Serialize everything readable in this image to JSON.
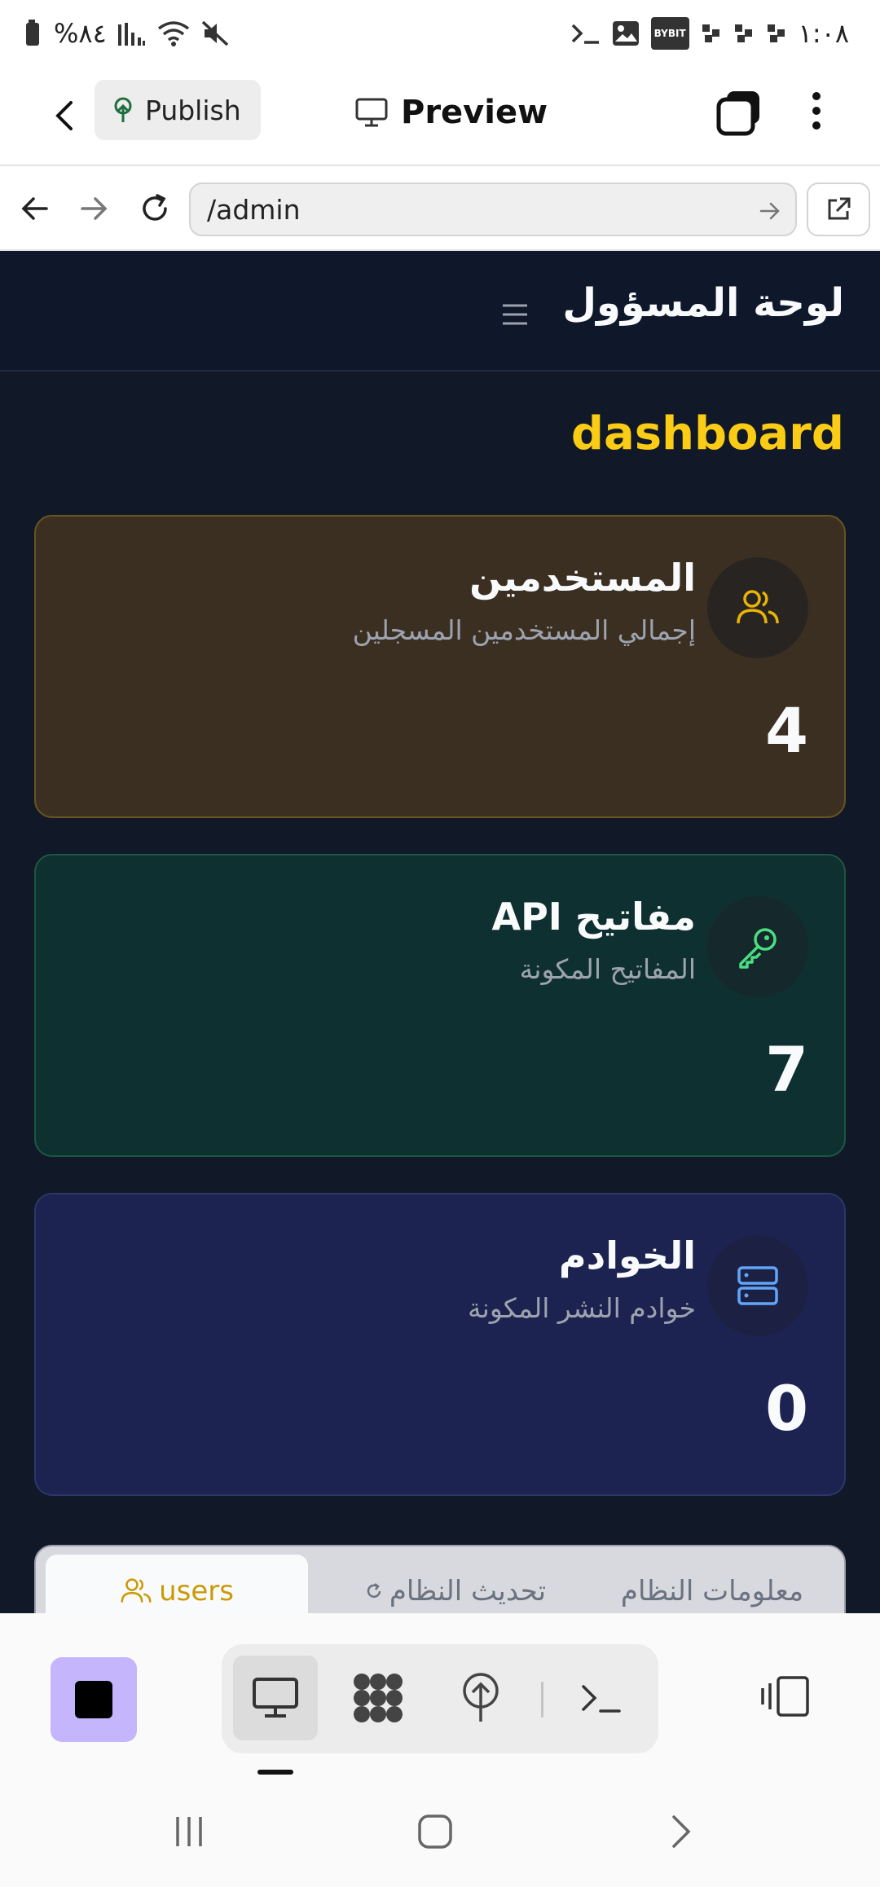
{
  "status_bar": {
    "battery": "%٨٤",
    "time": "١:٠٨",
    "notification_badge": "BYBIT"
  },
  "toolbar": {
    "publish_label": "Publish",
    "preview_label": "Preview"
  },
  "browser": {
    "url": "/admin"
  },
  "app": {
    "header_title": "لوحة المسؤول",
    "heading": "dashboard",
    "colors": {
      "heading": "#facc15",
      "background": "#111827"
    },
    "cards": [
      {
        "title": "المستخدمين",
        "subtitle": "إجمالي المستخدمين المسجلين",
        "value": "4",
        "icon": "users-icon"
      },
      {
        "title": "مفاتيح API",
        "subtitle": "المفاتيح المكونة",
        "value": "7",
        "icon": "key-icon"
      },
      {
        "title": "الخوادم",
        "subtitle": "خوادم النشر المكونة",
        "value": "0",
        "icon": "server-icon"
      }
    ],
    "tabs": [
      {
        "label": "users",
        "active": true
      },
      {
        "label": "تحديث النظام",
        "active": false
      },
      {
        "label": "معلومات النظام",
        "active": false
      }
    ]
  },
  "dock": {
    "buttons": [
      "stop-icon",
      "monitor-icon",
      "workspace-icon",
      "deploy-icon",
      "terminal-icon",
      "panels-icon"
    ]
  }
}
